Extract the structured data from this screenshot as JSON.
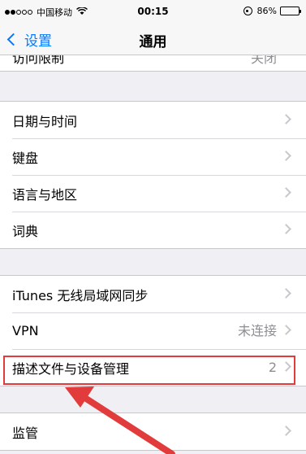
{
  "status_bar": {
    "carrier": "中国移动",
    "time": "00:15",
    "battery": "86%",
    "battery_level": 0.86
  },
  "nav": {
    "back_label": "设置",
    "title": "通用"
  },
  "partial_row": {
    "label": "访问限制",
    "value": "关闭"
  },
  "group1": [
    {
      "label": "日期与时间"
    },
    {
      "label": "键盘"
    },
    {
      "label": "语言与地区"
    },
    {
      "label": "词典"
    }
  ],
  "group2": [
    {
      "label": "iTunes 无线局域网同步",
      "value": ""
    },
    {
      "label": "VPN",
      "value": "未连接"
    },
    {
      "label": "描述文件与设备管理",
      "value": "2"
    }
  ],
  "group3": [
    {
      "label": "监管"
    }
  ],
  "colors": {
    "accent": "#007aff",
    "annotation": "#e23b3b"
  },
  "icons": [
    "wifi-icon",
    "orientation-lock-icon",
    "battery-icon",
    "back-chevron-icon",
    "chevron-right-icon"
  ]
}
